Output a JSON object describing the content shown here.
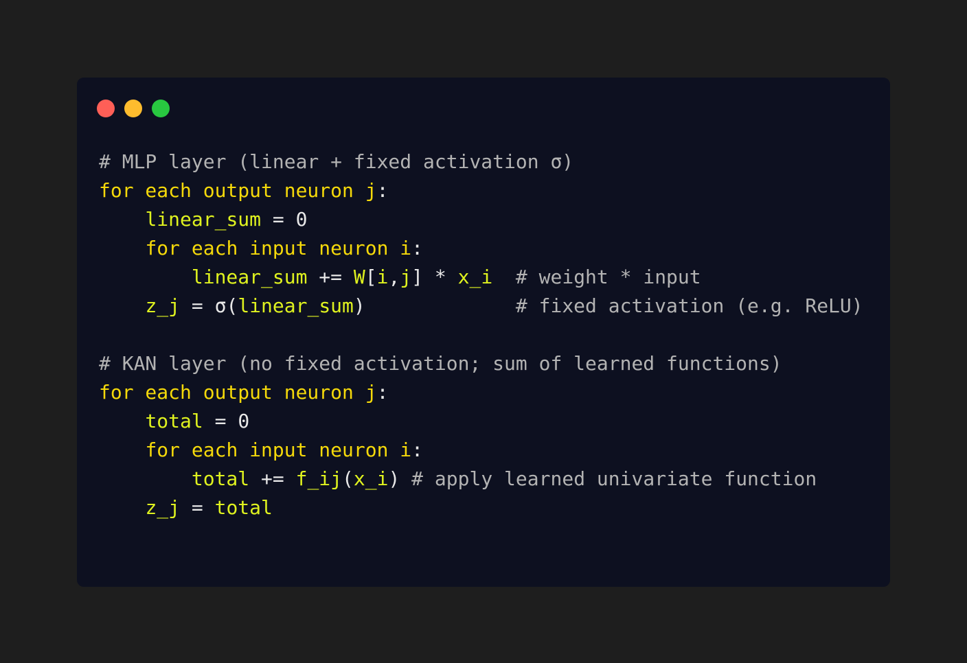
{
  "colors": {
    "page_background": "#1e1e1e",
    "window_background": "#0d1020",
    "dot_close": "#fe5f57",
    "dot_minimize": "#febc2e",
    "dot_maximize": "#28c840",
    "keyword": "#f5d90a",
    "identifier": "#dff21f",
    "comment": "#b3b3b3",
    "operator": "#e8e8e8"
  },
  "window": {
    "controls": [
      "close-dot",
      "minimize-dot",
      "maximize-dot"
    ]
  },
  "code": {
    "lines": [
      [
        {
          "t": "# MLP layer (linear + fixed activation σ)",
          "c": "cm"
        }
      ],
      [
        {
          "t": "for each output neuron j",
          "c": "kw"
        },
        {
          "t": ":",
          "c": "op"
        }
      ],
      [
        {
          "t": "    ",
          "c": "op"
        },
        {
          "t": "linear_sum",
          "c": "id"
        },
        {
          "t": " = ",
          "c": "op"
        },
        {
          "t": "0",
          "c": "num"
        }
      ],
      [
        {
          "t": "    ",
          "c": "op"
        },
        {
          "t": "for each input neuron i",
          "c": "kw"
        },
        {
          "t": ":",
          "c": "op"
        }
      ],
      [
        {
          "t": "        ",
          "c": "op"
        },
        {
          "t": "linear_sum",
          "c": "id"
        },
        {
          "t": " += ",
          "c": "op"
        },
        {
          "t": "W",
          "c": "id"
        },
        {
          "t": "[",
          "c": "op"
        },
        {
          "t": "i",
          "c": "id"
        },
        {
          "t": ",",
          "c": "op"
        },
        {
          "t": "j",
          "c": "id"
        },
        {
          "t": "] * ",
          "c": "op"
        },
        {
          "t": "x_i",
          "c": "id"
        },
        {
          "t": "  # weight * input",
          "c": "cm"
        }
      ],
      [
        {
          "t": "    ",
          "c": "op"
        },
        {
          "t": "z_j",
          "c": "id"
        },
        {
          "t": " = σ(",
          "c": "op"
        },
        {
          "t": "linear_sum",
          "c": "id"
        },
        {
          "t": ")",
          "c": "op"
        },
        {
          "t": "             # fixed activation (e.g. ReLU)",
          "c": "cm"
        }
      ],
      [],
      [
        {
          "t": "# KAN layer (no fixed activation; sum of learned functions)",
          "c": "cm"
        }
      ],
      [
        {
          "t": "for each output neuron j",
          "c": "kw"
        },
        {
          "t": ":",
          "c": "op"
        }
      ],
      [
        {
          "t": "    ",
          "c": "op"
        },
        {
          "t": "total",
          "c": "id"
        },
        {
          "t": " = ",
          "c": "op"
        },
        {
          "t": "0",
          "c": "num"
        }
      ],
      [
        {
          "t": "    ",
          "c": "op"
        },
        {
          "t": "for each input neuron i",
          "c": "kw"
        },
        {
          "t": ":",
          "c": "op"
        }
      ],
      [
        {
          "t": "        ",
          "c": "op"
        },
        {
          "t": "total",
          "c": "id"
        },
        {
          "t": " += ",
          "c": "op"
        },
        {
          "t": "f_ij",
          "c": "id"
        },
        {
          "t": "(",
          "c": "op"
        },
        {
          "t": "x_i",
          "c": "id"
        },
        {
          "t": ")",
          "c": "op"
        },
        {
          "t": " # apply learned univariate function",
          "c": "cm"
        }
      ],
      [
        {
          "t": "    ",
          "c": "op"
        },
        {
          "t": "z_j",
          "c": "id"
        },
        {
          "t": " = ",
          "c": "op"
        },
        {
          "t": "total",
          "c": "id"
        }
      ]
    ]
  }
}
